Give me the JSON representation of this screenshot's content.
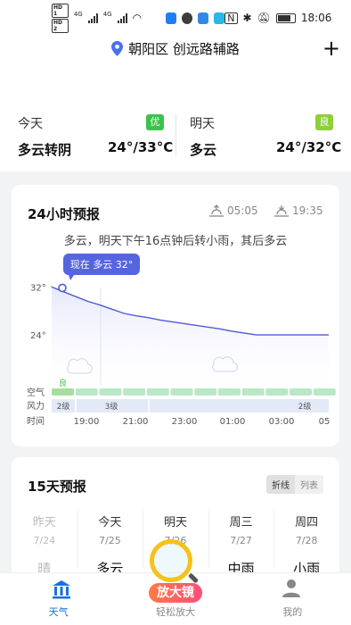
{
  "status_bar": {
    "sim1": "HD 1",
    "sim2": "HD 2",
    "net1": "4G",
    "net2": "4G",
    "time": "18:06"
  },
  "header": {
    "location": "朝阳区 创远路辅路",
    "add_label": "+"
  },
  "overview": {
    "today": {
      "label": "今天",
      "aqi": "优",
      "desc": "多云转阴",
      "temp": "24°/33°C"
    },
    "tomorrow": {
      "label": "明天",
      "aqi": "良",
      "desc": "多云",
      "temp": "24°/32°C"
    }
  },
  "hourly": {
    "title": "24小时预报",
    "sunrise": "05:05",
    "sunset": "19:35",
    "summary": "多云，明天下午16点钟后转小雨，其后多云",
    "now_label": "现在 多云 32°",
    "air_label": "空气",
    "air_quality_label": "良",
    "wind_label": "风力",
    "time_label": "时间",
    "wind_levels": [
      "2级",
      "3级",
      "2级"
    ],
    "colors": {
      "line": "#4f5bd5",
      "fill_top": "#e6e8fb",
      "air_good": "#b8e8c6",
      "air_moderate": "#a7dea0",
      "wind_bar": "#e4e9f7"
    }
  },
  "chart_data": {
    "type": "line",
    "title": "24小时预报",
    "x_ticks": [
      "19:00",
      "21:00",
      "23:00",
      "01:00",
      "03:00",
      "05"
    ],
    "y_ticks": [
      "32°",
      "24°"
    ],
    "ylim": [
      20,
      34
    ],
    "series": [
      {
        "values": [
          32,
          31.2,
          30.4,
          29.6,
          29.0,
          28.3,
          27.6,
          27.2,
          26.9,
          26.5,
          26.2,
          25.9,
          25.6,
          25.3,
          25.0,
          24.6,
          24.3,
          24.0,
          24.0,
          24.0,
          24.0,
          24.0,
          24.0,
          24.0
        ]
      }
    ]
  },
  "daily": {
    "title": "15天预报",
    "toggle": [
      "折线",
      "列表"
    ],
    "days": [
      {
        "name": "昨天",
        "date": "7/24",
        "weather": "晴"
      },
      {
        "name": "今天",
        "date": "7/25",
        "weather": "多云"
      },
      {
        "name": "明天",
        "date": "7/26",
        "weather": ""
      },
      {
        "name": "周三",
        "date": "7/27",
        "weather": "中雨"
      },
      {
        "name": "周四",
        "date": "7/28",
        "weather": "小雨"
      }
    ]
  },
  "overlay": {
    "magnifier_label": "放大镜"
  },
  "nav": {
    "weather": "天气",
    "relax": "轻松放大",
    "mine": "我的"
  }
}
